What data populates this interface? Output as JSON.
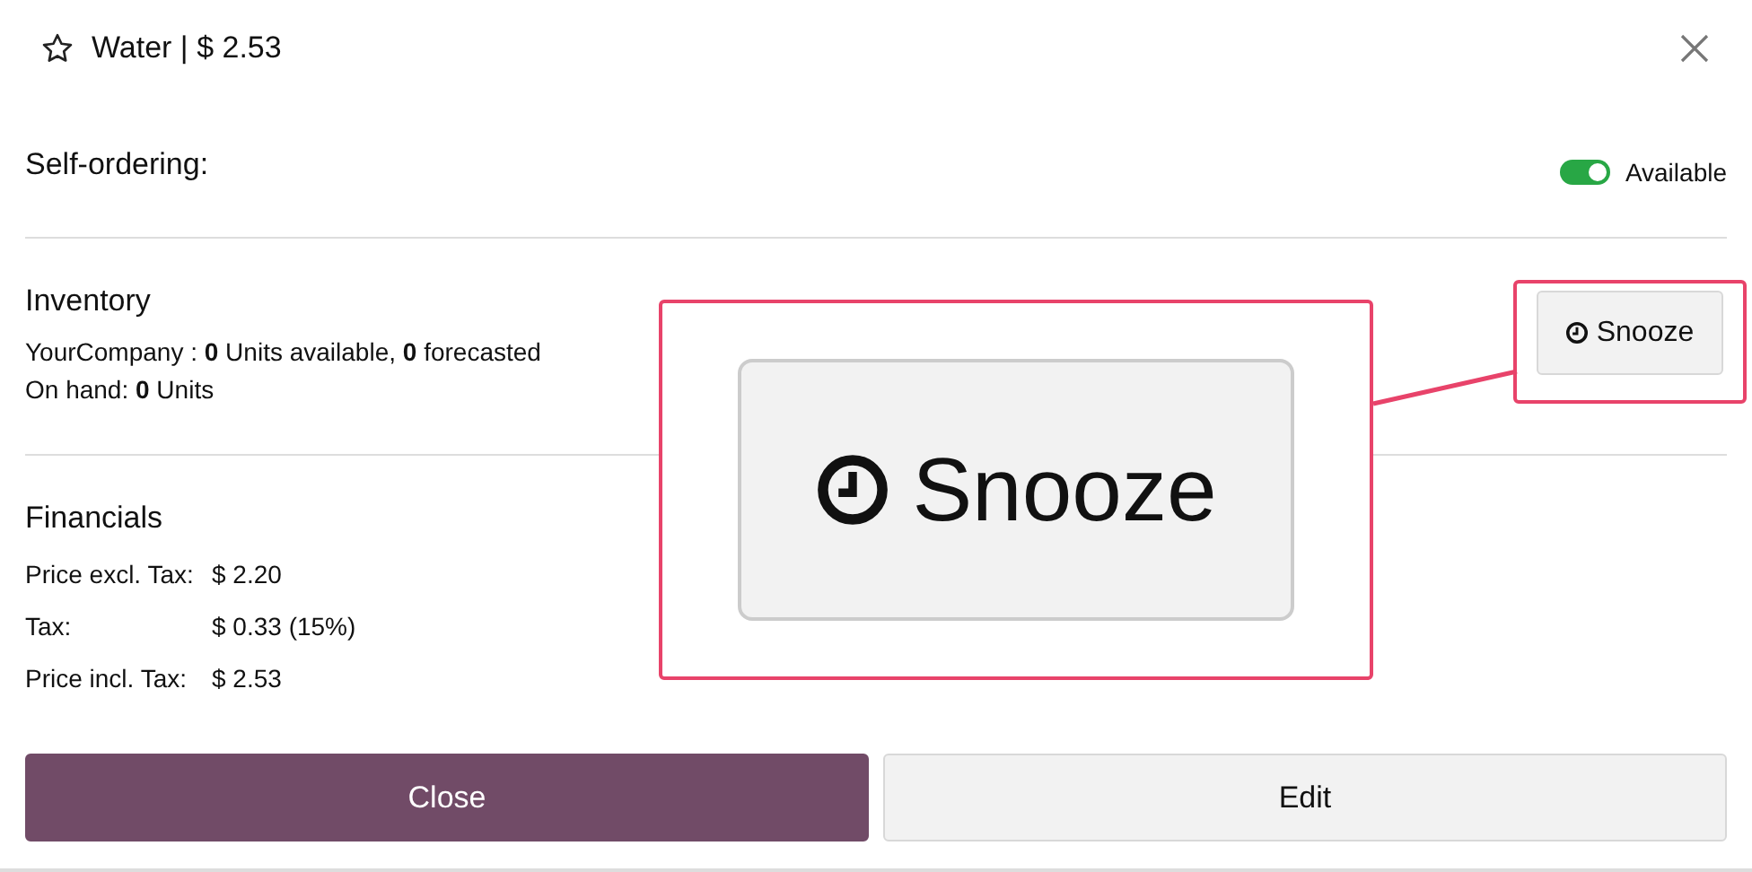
{
  "title": {
    "text": "Water | $ 2.53",
    "favorite": false
  },
  "self_ordering": {
    "label": "Self-ordering:",
    "available": true,
    "toggle_label": "Available"
  },
  "inventory": {
    "heading": "Inventory",
    "lines": [
      "YourCompany :  **0** Units available,  **0**  forecasted",
      "On hand: **0** Units"
    ],
    "snooze_label": "Snooze"
  },
  "financials": {
    "heading": "Financials",
    "rows": [
      {
        "label": "Price excl. Tax:",
        "value": "$ 2.20"
      },
      {
        "label": "Tax:",
        "value": "$ 0.33 (15%)"
      },
      {
        "label": "Price incl. Tax:",
        "value": "$ 2.53"
      }
    ]
  },
  "callout": {
    "label": "Snooze"
  },
  "buttons": [
    {
      "label": "Close",
      "kind": "primary"
    },
    {
      "label": "Edit",
      "kind": "secondary"
    }
  ]
}
